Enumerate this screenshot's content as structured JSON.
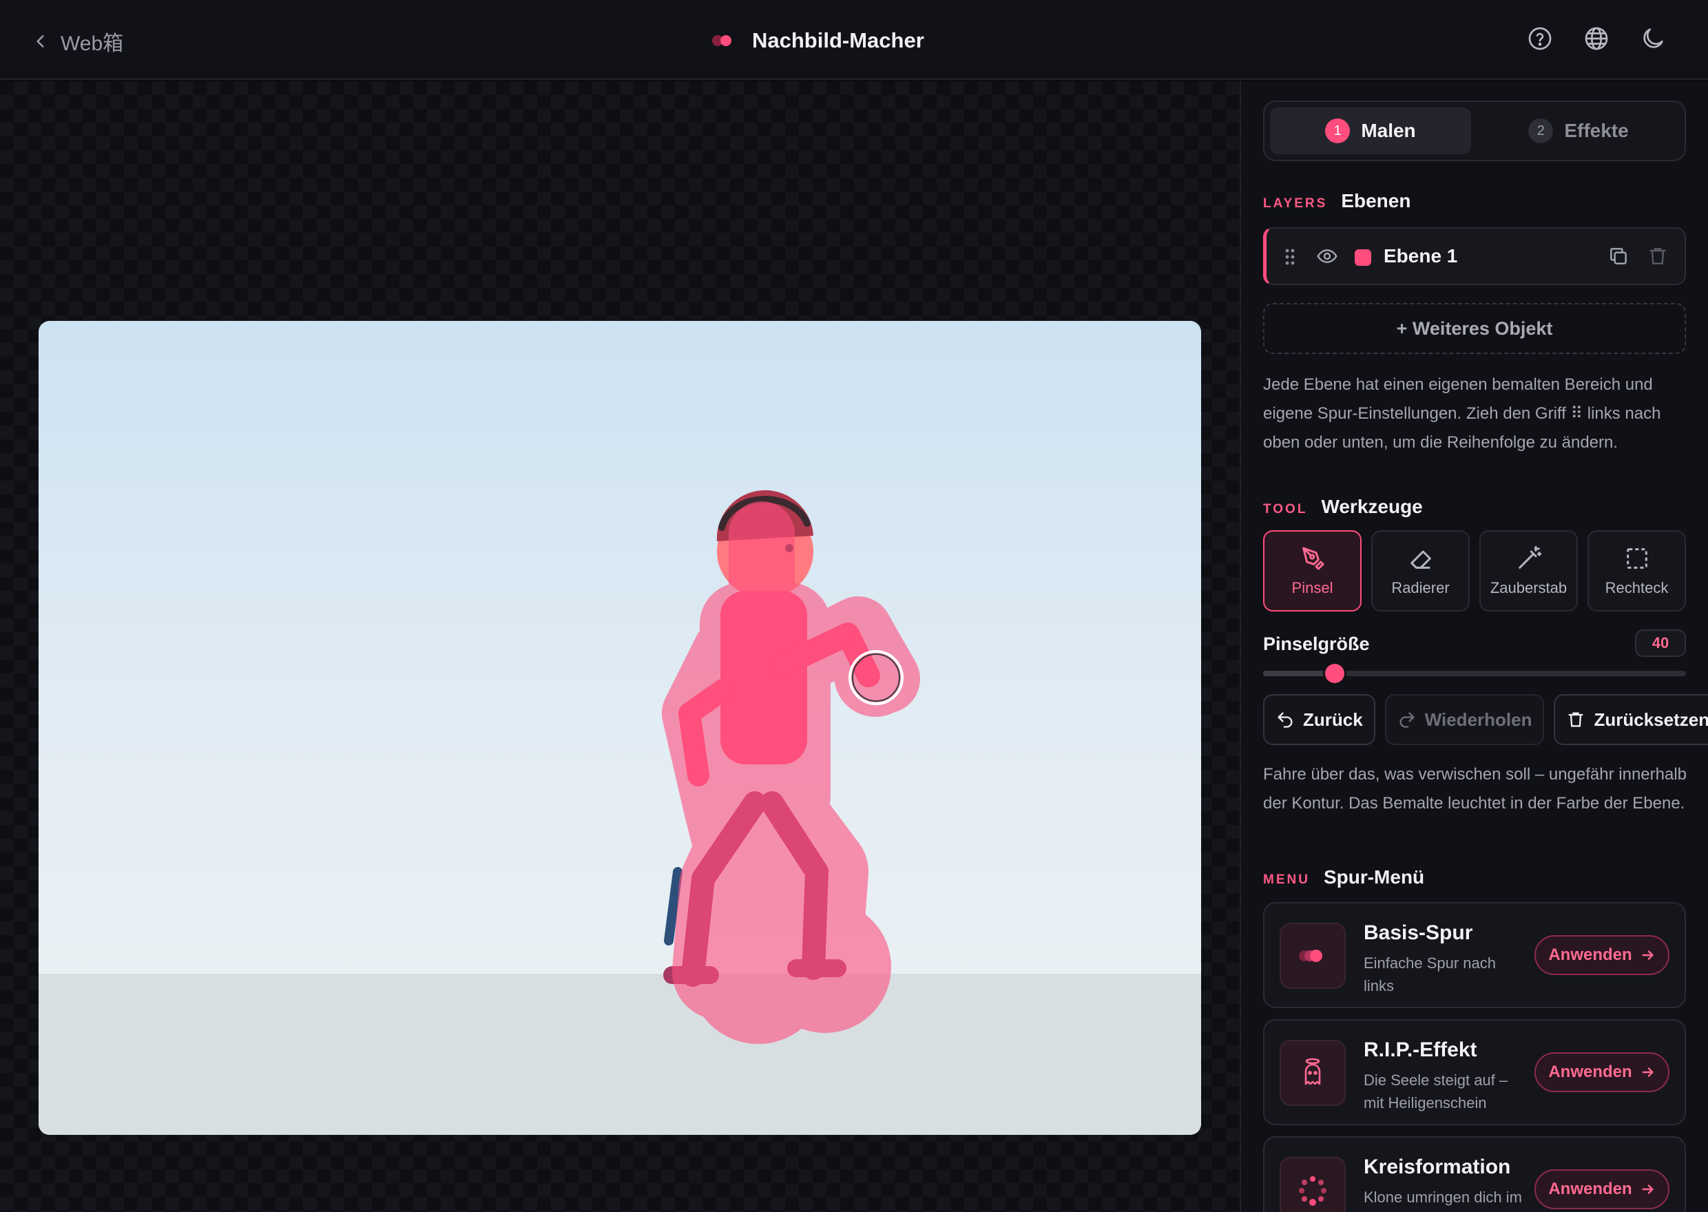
{
  "header": {
    "back_label": "Web箱",
    "app_title": "Nachbild-Macher",
    "icons": [
      "help-circle-icon",
      "globe-icon",
      "moon-icon"
    ]
  },
  "colors": {
    "accent": "#ff4d7d",
    "background": "#0b0c10",
    "panel": "#101116"
  },
  "tabs": [
    {
      "num": "1",
      "label": "Malen",
      "active": true
    },
    {
      "num": "2",
      "label": "Effekte",
      "active": false
    }
  ],
  "layers": {
    "tag": "LAYERS",
    "title": "Ebenen",
    "items": [
      {
        "name": "Ebene 1",
        "color": "#ff4d7d"
      }
    ],
    "add_label": "+ Weiteres Objekt",
    "help": "Jede Ebene hat einen eigenen bemalten Bereich und eigene Spur-Einstellungen. Zieh den Griff ⠿ links nach oben oder unten, um die Reihenfolge zu ändern."
  },
  "tools": {
    "tag": "TOOL",
    "title": "Werkzeuge",
    "items": [
      {
        "label": "Pinsel",
        "icon": "pen-brush-icon",
        "active": true
      },
      {
        "label": "Radierer",
        "icon": "eraser-icon",
        "active": false
      },
      {
        "label": "Zauberstab",
        "icon": "magic-wand-icon",
        "active": false
      },
      {
        "label": "Rechteck",
        "icon": "rectangle-select-icon",
        "active": false
      }
    ],
    "brush_size_label": "Pinselgröße",
    "brush_size_value": "40",
    "brush_size_fraction": 0.17
  },
  "actions": {
    "undo": "Zurück",
    "redo": "Wiederholen",
    "reset": "Zurücksetzen"
  },
  "paint_help": "Fahre über das, was verwischen soll – ungefähr innerhalb der Kontur. Das Bemalte leuchtet in der Farbe der Ebene.",
  "menu": {
    "tag": "MENU",
    "title": "Spur-Menü",
    "apply_label": "Anwenden",
    "items": [
      {
        "title": "Basis-Spur",
        "desc": "Einfache Spur nach links",
        "icon": "trail-dots-icon"
      },
      {
        "title": "R.I.P.-Effekt",
        "desc": "Die Seele steigt auf – mit Heiligenschein",
        "icon": "ghost-halo-icon"
      },
      {
        "title": "Kreisformation",
        "desc": "Klone umringen dich im Kreis",
        "icon": "circle-formation-icon"
      }
    ]
  }
}
